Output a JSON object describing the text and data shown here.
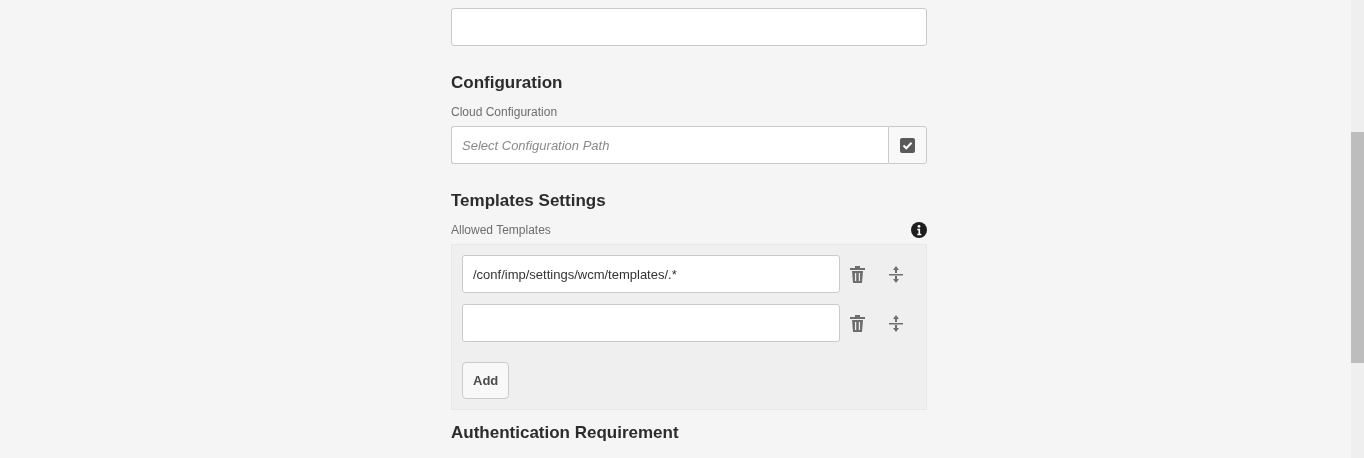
{
  "sections": [
    {
      "title": "Configuration",
      "label": "Cloud Configuration",
      "kind": "picker",
      "placeholder": "Select Configuration Path"
    },
    {
      "title": "Templates Settings",
      "label": "Allowed Templates",
      "kind": "multifield",
      "items": [
        {
          "kind": "filled",
          "value": "/conf/imp/settings/wcm/templates/.*"
        },
        {
          "kind": "blank"
        }
      ],
      "add_button": "Add"
    }
  ],
  "next_section_title": "Authentication Requirement"
}
